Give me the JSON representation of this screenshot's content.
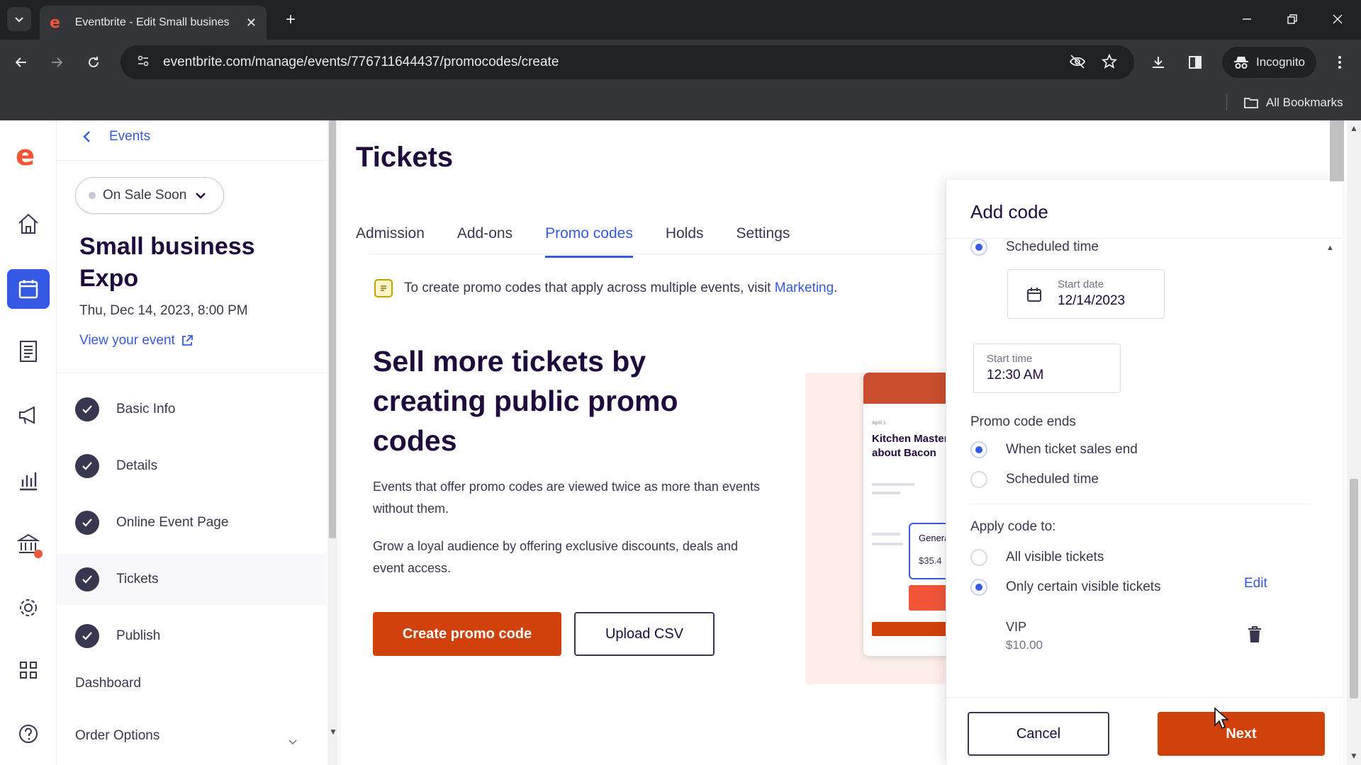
{
  "browser": {
    "tab_title": "Eventbrite - Edit Small busines",
    "tab_close": "✕",
    "new_tab": "+",
    "url": "eventbrite.com/manage/events/776711644437/promocodes/create",
    "incognito_label": "Incognito",
    "all_bookmarks_label": "All Bookmarks",
    "icons": [
      "tab-dropdown-icon",
      "eventbrite-favicon",
      "back-icon",
      "forward-icon",
      "reload-icon",
      "site-settings-icon",
      "eye-off-icon",
      "star-icon",
      "download-icon",
      "sidebar-icon",
      "incognito-icon",
      "menu-icon",
      "folder-icon"
    ]
  },
  "rail": {
    "logo": "e",
    "items": [
      "home-icon",
      "calendar-icon",
      "orders-icon",
      "megaphone-icon",
      "reports-icon",
      "finance-icon",
      "settings-icon",
      "apps-icon",
      "help-icon"
    ]
  },
  "sidebar": {
    "back_label": "Events",
    "status": "On Sale Soon",
    "event_title": "Small business Expo",
    "event_date": "Thu, Dec 14, 2023, 8:00 PM",
    "view_event": "View your event",
    "steps": [
      {
        "label": "Basic Info"
      },
      {
        "label": "Details"
      },
      {
        "label": "Online Event Page"
      },
      {
        "label": "Tickets"
      },
      {
        "label": "Publish"
      }
    ],
    "dashboard": "Dashboard",
    "order_options": "Order Options"
  },
  "main": {
    "title": "Tickets",
    "tabs": [
      {
        "label": "Admission"
      },
      {
        "label": "Add-ons"
      },
      {
        "label": "Promo codes",
        "active": true
      },
      {
        "label": "Holds"
      },
      {
        "label": "Settings"
      }
    ],
    "notice_text": "To create promo codes that apply across multiple events, visit ",
    "notice_link": "Marketing",
    "notice_end": ".",
    "promo_heading": "Sell more tickets by creating public promo codes",
    "promo_p1": "Events that offer promo codes are viewed twice as more than events without them.",
    "promo_p2": "Grow a loyal audience by offering exclusive discounts, deals and event access.",
    "create_button": "Create promo code",
    "upload_button": "Upload CSV",
    "illustration": {
      "small_text": "April 1",
      "title": "Kitchen MasterClass about Bacon",
      "ticket_name": "General",
      "ticket_price": "$35.4"
    }
  },
  "panel": {
    "title": "Add code",
    "start_option": "Scheduled time",
    "start_date_label": "Start date",
    "start_date_value": "12/14/2023",
    "start_time_label": "Start time",
    "start_time_value": "12:30 AM",
    "ends_heading": "Promo code ends",
    "ends_options": [
      "When ticket sales end",
      "Scheduled time"
    ],
    "apply_heading": "Apply code to:",
    "apply_options": [
      "All visible tickets",
      "Only certain visible tickets"
    ],
    "edit_label": "Edit",
    "ticket": {
      "name": "VIP",
      "price": "$10.00"
    },
    "cancel_button": "Cancel",
    "next_button": "Next"
  },
  "colors": {
    "brand_orange": "#d1410c",
    "link_blue": "#3659e3",
    "text_dark": "#1e0a3c"
  }
}
